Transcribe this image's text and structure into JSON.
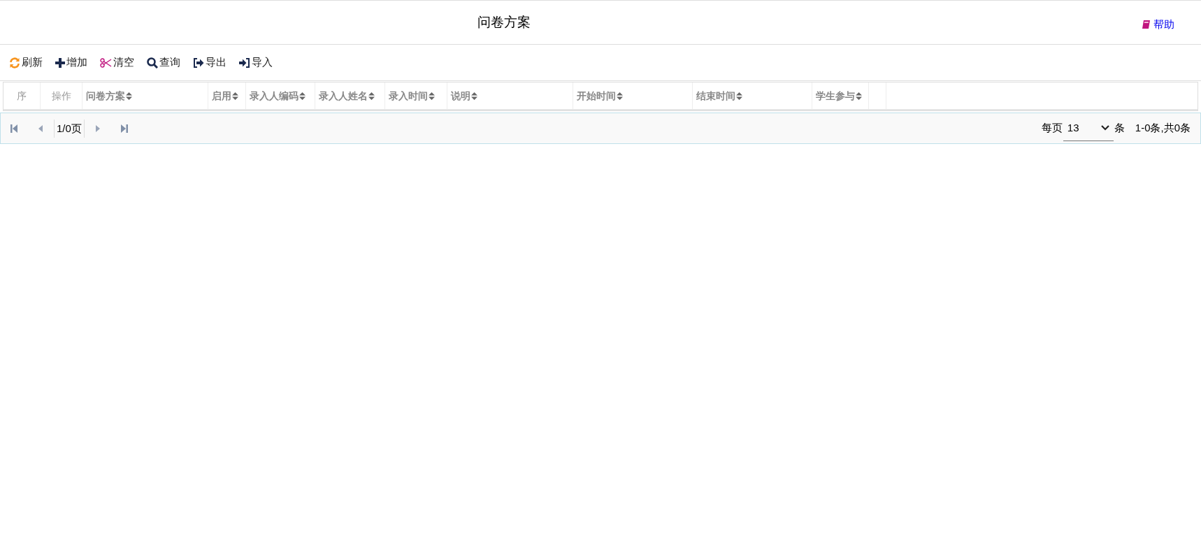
{
  "header": {
    "title": "问卷方案",
    "help_link": "帮助"
  },
  "toolbar": [
    {
      "kind": "refresh",
      "label": "刷新"
    },
    {
      "kind": "add",
      "label": "增加"
    },
    {
      "kind": "clear",
      "label": "清空"
    },
    {
      "kind": "search",
      "label": "查询"
    },
    {
      "kind": "export",
      "label": "导出"
    },
    {
      "kind": "import",
      "label": "导入"
    }
  ],
  "table": {
    "columns": [
      {
        "label": "序",
        "sortable": false
      },
      {
        "label": "操作",
        "sortable": false
      },
      {
        "label": "问卷方案",
        "sortable": true
      },
      {
        "label": "启用",
        "sortable": true
      },
      {
        "label": "录入人编码",
        "sortable": true
      },
      {
        "label": "录入人姓名",
        "sortable": true
      },
      {
        "label": "录入时间",
        "sortable": true
      },
      {
        "label": "说明",
        "sortable": true
      },
      {
        "label": "开始时间",
        "sortable": true
      },
      {
        "label": "结束时间",
        "sortable": true
      },
      {
        "label": "学生参与",
        "sortable": true
      }
    ]
  },
  "pager": {
    "page_info": "1/0页",
    "per_page_label": "每页",
    "per_page_value": "13",
    "unit": "条",
    "summary": "1-0条,共0条"
  }
}
